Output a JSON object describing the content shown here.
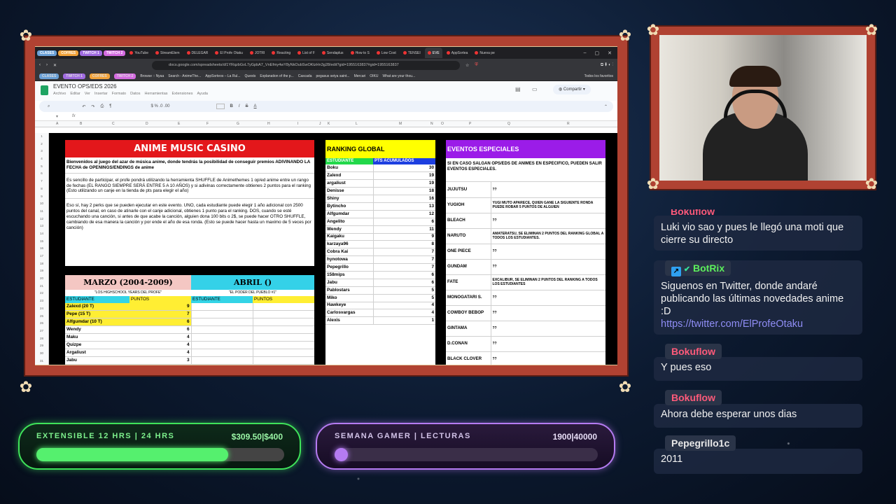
{
  "browser": {
    "tab_groups": [
      {
        "label": "CLASES",
        "color": "#6aa0d6"
      },
      {
        "label": "COFRES",
        "color": "#f2a33a"
      },
      {
        "label": "TWITCH 1",
        "color": "#a06be0"
      },
      {
        "label": "TWITCH 2",
        "color": "#d46be0"
      }
    ],
    "tabs": [
      "YouTube",
      "StreamElem",
      "DELEGAR",
      "El Profe Otaku",
      "JOTRI",
      "Reacting",
      "List of F",
      "Sendaplus",
      "How to S",
      "Low Cost",
      "TENSEI",
      "EVE",
      "AppSortea",
      "Nueva pe"
    ],
    "url": "docs.google.com/spreadsheets/d/1YRqzbGvL7yGpbA7_VnEfmy4wY8yNkOubSwOKtzHn3g28/edit?gid=1955163837#gid=1955163837",
    "bookmarks": [
      "CLASES",
      "TWITCH 1",
      "COFRES",
      "TWITCH 2",
      "Browse :: Nyaa",
      "Search - AnimeThe...",
      "AppSorteos – La Rul...",
      "Quests",
      "Explanation of the p...",
      "Cascada",
      "pegasus seiya saint...",
      "Mercari",
      "OIKU",
      "What are your thou...",
      "Todos los favoritos"
    ]
  },
  "sheet": {
    "doc_title": "EVENTO OPS/EDS 2026",
    "menus": [
      "Archivo",
      "Editar",
      "Ver",
      "Insertar",
      "Formato",
      "Datos",
      "Herramientas",
      "Extensiones",
      "Ayuda"
    ],
    "share_label": "Compartir",
    "columns": [
      "A",
      "B",
      "C",
      "D",
      "E",
      "F",
      "G",
      "H",
      "I",
      "J",
      "K",
      "L",
      "M",
      "N",
      "O",
      "P",
      "Q",
      "R"
    ],
    "rows": [
      "1",
      "2",
      "3",
      "4",
      "5",
      "6",
      "7",
      "8",
      "9",
      "10",
      "11",
      "12",
      "13",
      "14",
      "15",
      "16",
      "17",
      "18",
      "19",
      "20",
      "21",
      "22",
      "23",
      "24",
      "25",
      "26",
      "27",
      "28",
      "29",
      "30",
      "31"
    ]
  },
  "casino": {
    "title": "ANIME MUSIC CASINO",
    "p1": "Bienvenidos al juego del azar de música anime, donde tendrás la posibilidad de conseguir premios ADIVINANDO LA FECHA de OPENINGS/ENDINGS de anime",
    "p2": "Es sencillo de participar, el profe pondrá utilizando la herramienta SHUFFLE de Animethemes 1 op/ed anime entre un rango de fechas (EL RANGO SIEMPRE SERÁ ENTRE 5 A 10 AÑOS) y si adivinas correctamente obtienes 2 puntos para el ranking (Esto utilizando un canje en la tienda de pts para elegir el año)",
    "p3": "Eso sí, hay 2 perks que se pueden ejecutar en este evento. UNO, cada estudiante puede elegir 1 año adicional con 2500 puntos del canal, en caso de atinarle con el canje adicional, obtienes 1 punto para el ranking. DOS, cuando se esté escuchando una canción, si antes de que acabe la canción, alguien dona 100 bits o 2$, se puede hacer OTRO SHUFFLE, cambiando de esa manera la canción y por ende el año de esa ronda. (Esto se puede hacer hasta un maximo de 5 veces por canción)"
  },
  "marzo": {
    "title": "MARZO (2004-2009)",
    "subtitle": "\"LOS HIGHSCHOOL YEARS DEL PROFE\"",
    "col1": "ESTUDIANTE",
    "col2": "PUNTOS",
    "rows": [
      {
        "n": "Zalexd (20 T)",
        "p": "9"
      },
      {
        "n": "Pepe (15 T)",
        "p": "7"
      },
      {
        "n": "Alfgumdar (10 T)",
        "p": "6"
      },
      {
        "n": "Wendy",
        "p": "6"
      },
      {
        "n": "Maku",
        "p": "4"
      },
      {
        "n": "Quizpe",
        "p": "4"
      },
      {
        "n": "Argaliust",
        "p": "4"
      },
      {
        "n": "Jabu",
        "p": "3"
      }
    ]
  },
  "abril": {
    "title": "ABRIL ()",
    "subtitle": "\"EL PODER DEL PUEBLO #1\"",
    "col1": "ESTUDIANTE",
    "col2": "PUNTOS"
  },
  "ranking": {
    "title": "RANKING GLOBAL",
    "col1": "ESTUDIANTE",
    "col2": "PTS ACUMULADOS",
    "rows": [
      {
        "n": "Boku",
        "p": "30"
      },
      {
        "n": "Zalexd",
        "p": "19"
      },
      {
        "n": "argaliust",
        "p": "19"
      },
      {
        "n": "Denisse",
        "p": "18"
      },
      {
        "n": "Shiny",
        "p": "16"
      },
      {
        "n": "Bytincho",
        "p": "13"
      },
      {
        "n": "Alfgumdar",
        "p": "12"
      },
      {
        "n": "Angelito",
        "p": "6"
      },
      {
        "n": "Wendy",
        "p": "11"
      },
      {
        "n": "Kaigaku",
        "p": "9"
      },
      {
        "n": "karzaya96",
        "p": "8"
      },
      {
        "n": "Cobra Kai",
        "p": "7"
      },
      {
        "n": "hynotowa",
        "p": "7"
      },
      {
        "n": "Pepegrillo",
        "p": "7"
      },
      {
        "n": "158mips",
        "p": "6"
      },
      {
        "n": "Jabu",
        "p": "6"
      },
      {
        "n": "Pablostars",
        "p": "5"
      },
      {
        "n": "Miko",
        "p": "5"
      },
      {
        "n": "Hawkeye",
        "p": "4"
      },
      {
        "n": "Carlosvargas",
        "p": "4"
      },
      {
        "n": "Alexis",
        "p": "1"
      }
    ]
  },
  "eventos": {
    "title": "EVENTOS ESPECIALES",
    "intro": "SI EN CASO SALGAN OPS/EDS DE ANIMES EN ESPECIFICO, PUEDEN SALIR EVENTOS ESPECIALES.",
    "rows": [
      {
        "a": "JUJUTSU",
        "d": "??"
      },
      {
        "a": "YUGIOH",
        "d": "YUGI MUTO APARECE, QUIEN GANE LA SIGUIENTE RONDA PUEDE ROBAR 5 PUNTOS DE ALGUIEN"
      },
      {
        "a": "BLEACH",
        "d": "??"
      },
      {
        "a": "NARUTO",
        "d": "AMATERATSU, SE ELIMINAN 2 PUNTOS DEL RANKING GLOBAL A TODOS LOS ESTUDIANTES."
      },
      {
        "a": "ONE PIECE",
        "d": "??"
      },
      {
        "a": "GUNDAM",
        "d": "??"
      },
      {
        "a": "FATE",
        "d": "EXCALIBUR, SE ELIMINAN 2 PUNTOS DEL RANKING A TODOS LOS ESTUDIANTES"
      },
      {
        "a": "MONOGATARI S.",
        "d": "??"
      },
      {
        "a": "COWBOY BEBOP",
        "d": "??"
      },
      {
        "a": "GINTAMA",
        "d": "??"
      },
      {
        "a": "D.CONAN",
        "d": "??"
      },
      {
        "a": "BLACK CLOVER",
        "d": "??"
      }
    ]
  },
  "chat": {
    "partial_user": "Bokuflow",
    "m1": "Luki vio sao y pues le llegó una moti que cierre su directo",
    "u2": "BotRix",
    "m2": "Siguenos en Twitter, donde andaré publicando las últimas novedades anime :D",
    "m2_link": "https://twitter.com/ElProfeOtaku",
    "u3": "Bokuflow",
    "m3": "Y pues eso",
    "u4": "Bokuflow",
    "m4": "Ahora debe esperar unos dias",
    "u5": "Pepegrillo1c",
    "m5": "2011"
  },
  "goals": {
    "g1": {
      "label": "EXTENSIBLE 12 HRS | 24 HRS",
      "value": "$309.50|$400",
      "progress": 0.774,
      "color": "#4cf066"
    },
    "g2": {
      "label": "SEMANA GAMER | LECTURAS",
      "value": "1900|40000",
      "progress": 0.0475,
      "color": "#b57bf2"
    }
  }
}
